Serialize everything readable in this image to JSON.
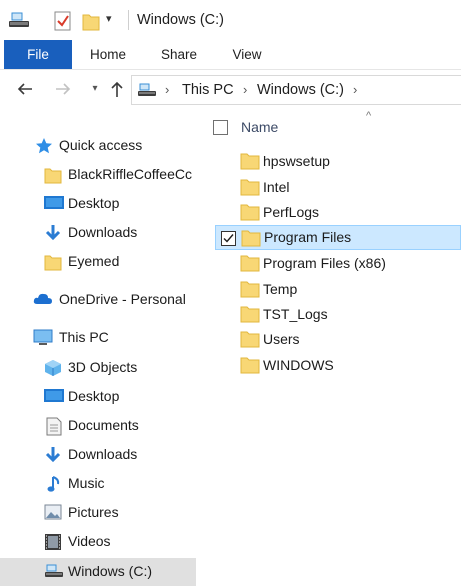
{
  "window": {
    "title": "Windows (C:)"
  },
  "ribbon": {
    "tabs": [
      {
        "label": "File",
        "active": true
      },
      {
        "label": "Home"
      },
      {
        "label": "Share"
      },
      {
        "label": "View"
      }
    ]
  },
  "address": {
    "crumbs": [
      "This PC",
      "Windows (C:)"
    ]
  },
  "nav_pane": {
    "items": [
      {
        "label": "Quick access",
        "icon": "star-icon"
      },
      {
        "label": "BlackRiffleCoffeeCc",
        "icon": "folder-icon"
      },
      {
        "label": "Desktop",
        "icon": "desktop-icon"
      },
      {
        "label": "Downloads",
        "icon": "download-icon"
      },
      {
        "label": "Eyemed",
        "icon": "folder-icon"
      },
      {
        "label": "OneDrive - Personal",
        "icon": "cloud-icon"
      },
      {
        "label": "This PC",
        "icon": "computer-icon"
      },
      {
        "label": "3D Objects",
        "icon": "cube-icon"
      },
      {
        "label": "Desktop",
        "icon": "desktop-icon"
      },
      {
        "label": "Documents",
        "icon": "document-icon"
      },
      {
        "label": "Downloads",
        "icon": "download-icon"
      },
      {
        "label": "Music",
        "icon": "music-icon"
      },
      {
        "label": "Pictures",
        "icon": "picture-icon"
      },
      {
        "label": "Videos",
        "icon": "video-icon"
      },
      {
        "label": "Windows (C:)",
        "icon": "drive-icon",
        "selected": true
      }
    ]
  },
  "content": {
    "column_header": "Name",
    "files": [
      {
        "name": "hpswsetup"
      },
      {
        "name": "Intel"
      },
      {
        "name": "PerfLogs"
      },
      {
        "name": "Program Files",
        "selected": true,
        "checked": true
      },
      {
        "name": "Program Files (x86)"
      },
      {
        "name": "Temp"
      },
      {
        "name": "TST_Logs"
      },
      {
        "name": "Users"
      },
      {
        "name": "WINDOWS"
      }
    ]
  },
  "colors": {
    "file_tab": "#195fbd",
    "folder": "#f8d775",
    "selection": "#cce8ff",
    "selection_border": "#99d1ff",
    "nav_selected": "#e0e0e0"
  }
}
